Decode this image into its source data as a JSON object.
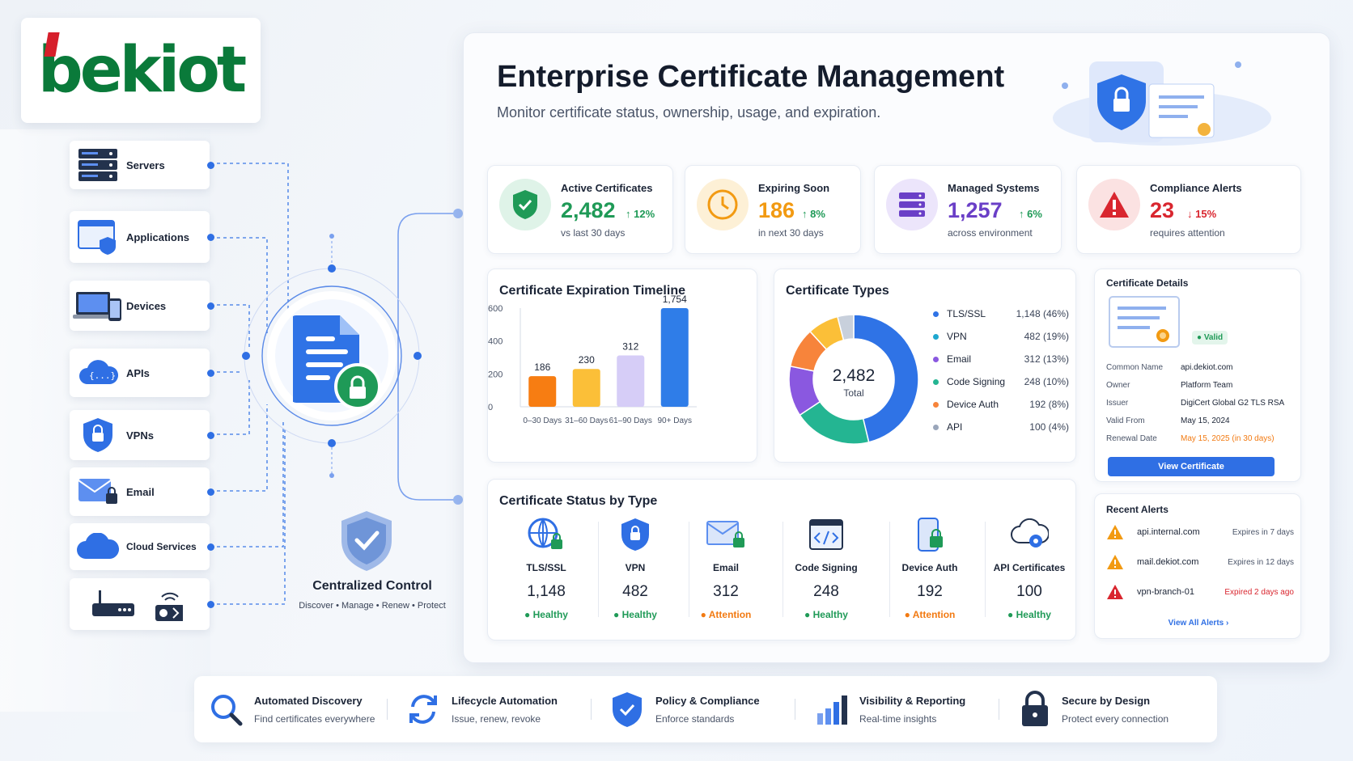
{
  "brand": {
    "logo_text": "bekiot"
  },
  "systems": [
    {
      "label": "Servers",
      "icon": "server-rack-icon"
    },
    {
      "label": "Applications",
      "icon": "application-window-icon"
    },
    {
      "label": "Devices",
      "icon": "laptop-phone-icon"
    },
    {
      "label": "APIs",
      "icon": "api-cloud-icon"
    },
    {
      "label": "VPNs",
      "icon": "vpn-shield-icon"
    },
    {
      "label": "Email",
      "icon": "email-lock-icon"
    },
    {
      "label": "Cloud Services",
      "icon": "cloud-icon"
    },
    {
      "label": "",
      "icon": "router-iot-icon"
    }
  ],
  "central": {
    "title": "Centralized Control",
    "subtitle": "Discover • Manage • Renew • Protect"
  },
  "header": {
    "title": "Enterprise Certificate Management",
    "subtitle": "Monitor certificate status, ownership, usage, and expiration."
  },
  "stats": [
    {
      "label": "Active Certificates",
      "value": "2,482",
      "trend": "↑ 12%",
      "sub": "vs last 30 days",
      "value_color": "#1f9a57",
      "trend_color": "#1f9a57",
      "icon": "shield-check-icon"
    },
    {
      "label": "Expiring Soon",
      "value": "186",
      "trend": "↑ 8%",
      "sub": "in next 30 days",
      "value_color": "#f29a12",
      "trend_color": "#1f9a57",
      "icon": "clock-icon"
    },
    {
      "label": "Managed Systems",
      "value": "1,257",
      "trend": "↑ 6%",
      "sub": "across environment",
      "value_color": "#6a3fc7",
      "trend_color": "#1f9a57",
      "icon": "server-icon"
    },
    {
      "label": "Compliance Alerts",
      "value": "23",
      "trend": "↓ 15%",
      "sub": "requires attention",
      "value_color": "#d9262f",
      "trend_color": "#d9262f",
      "icon": "warning-icon"
    }
  ],
  "timeline": {
    "title": "Certificate Expiration Timeline",
    "chart_data": {
      "type": "bar",
      "categories": [
        "0–30 Days",
        "31–60 Days",
        "61–90 Days",
        "90+ Days"
      ],
      "values": [
        186,
        230,
        312,
        1754
      ],
      "value_labels": [
        "186",
        "230",
        "312",
        "1,754"
      ],
      "yticks": [
        "0",
        "200",
        "400",
        "600"
      ],
      "colors": [
        "#f77d12",
        "#fbbf38",
        "#d6cdf7",
        "#2f7de8"
      ]
    }
  },
  "types": {
    "title": "Certificate Types",
    "total": "2,482",
    "total_label": "Total",
    "chart_data": {
      "type": "pie",
      "labels": [
        "TLS/SSL",
        "VPN",
        "Email",
        "Code Signing",
        "Device Auth",
        "API"
      ],
      "values": [
        1148,
        482,
        312,
        248,
        192,
        100
      ],
      "display": [
        "1,148 (46%)",
        "482 (19%)",
        "312 (13%)",
        "248 (10%)",
        "192 (8%)",
        "100 (4%)"
      ],
      "colors": [
        "#2f73e6",
        "#1ea7cf",
        "#8a58e0",
        "#24b592",
        "#f7843b",
        "#9aa6ba"
      ],
      "donut_colors": [
        "#2f73e6",
        "#24b592",
        "#8a58e0",
        "#f7843b",
        "#fbbf38",
        "#c8d0dc"
      ]
    }
  },
  "details": {
    "title": "Certificate Details",
    "badge": "● Valid",
    "rows": [
      {
        "k": "Common Name",
        "v": "api.dekiot.com"
      },
      {
        "k": "Owner",
        "v": "Platform Team"
      },
      {
        "k": "Issuer",
        "v": "DigiCert Global G2 TLS RSA"
      },
      {
        "k": "Valid From",
        "v": "May 15, 2024"
      },
      {
        "k": "Renewal Date",
        "v": "May 15, 2025 (in 30 days)"
      }
    ],
    "button": "View Certificate"
  },
  "alerts": {
    "title": "Recent Alerts",
    "items": [
      {
        "name": "api.internal.com",
        "time": "Expires in 7 days",
        "color": "#f29a12"
      },
      {
        "name": "mail.dekiot.com",
        "time": "Expires in 12 days",
        "color": "#f29a12"
      },
      {
        "name": "vpn-branch-01",
        "time": "Expired 2 days ago",
        "color": "#d9262f"
      }
    ],
    "link": "View All Alerts  ›"
  },
  "status": {
    "title": "Certificate Status by Type",
    "items": [
      {
        "label": "TLS/SSL",
        "count": "1,148",
        "status": "● Healthy",
        "color": "#1f9a57",
        "icon": "globe-lock-icon"
      },
      {
        "label": "VPN",
        "count": "482",
        "status": "● Healthy",
        "color": "#1f9a57",
        "icon": "shield-lock-icon"
      },
      {
        "label": "Email",
        "count": "312",
        "status": "● Attention",
        "color": "#f27a12",
        "icon": "envelope-lock-icon"
      },
      {
        "label": "Code Signing",
        "count": "248",
        "status": "● Healthy",
        "color": "#1f9a57",
        "icon": "code-window-icon"
      },
      {
        "label": "Device Auth",
        "count": "192",
        "status": "● Attention",
        "color": "#f27a12",
        "icon": "phone-lock-icon"
      },
      {
        "label": "API Certificates",
        "count": "100",
        "status": "● Healthy",
        "color": "#1f9a57",
        "icon": "cloud-gear-icon"
      }
    ]
  },
  "features": [
    {
      "title": "Automated Discovery",
      "sub": "Find certificates everywhere",
      "icon": "magnifier-icon"
    },
    {
      "title": "Lifecycle Automation",
      "sub": "Issue, renew, revoke",
      "icon": "refresh-cycle-icon"
    },
    {
      "title": "Policy & Compliance",
      "sub": "Enforce standards",
      "icon": "shield-check-icon"
    },
    {
      "title": "Visibility & Reporting",
      "sub": "Real-time insights",
      "icon": "bar-chart-icon"
    },
    {
      "title": "Secure by Design",
      "sub": "Protect every connection",
      "icon": "padlock-icon"
    }
  ]
}
